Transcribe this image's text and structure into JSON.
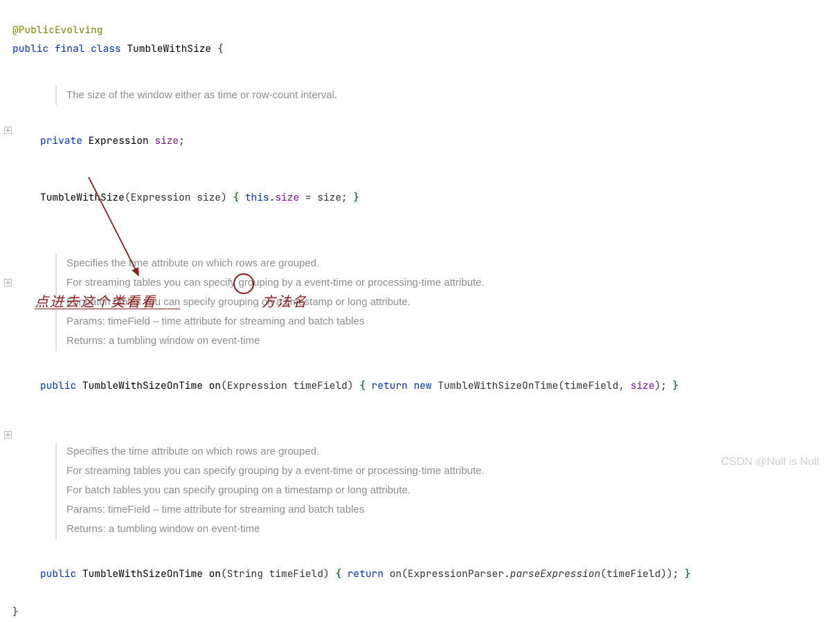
{
  "annotation": "@PublicEvolving",
  "decl": {
    "kw1": "public",
    "kw2": "final",
    "kw3": "class",
    "name": "TumbleWithSize",
    "brace": "{"
  },
  "doc1": "The size of the window either as time or row-count interval.",
  "field": {
    "kw": "private",
    "type": "Expression",
    "name": "size",
    "semi": ";"
  },
  "ctor": {
    "name": "TumbleWithSize",
    "params": "(Expression size)",
    "bopen": "{",
    "thisKw": "this",
    "dot": ".",
    "prop": "size",
    "assign": " = size; ",
    "bclose": "}"
  },
  "doc2": {
    "l1": "Specifies the time attribute on which rows are grouped.",
    "l2": "For streaming tables you can specify grouping by a event-time or processing-time attribute.",
    "l3": "For batch tables you can specify grouping on a timestamp or long attribute.",
    "l4": "Params:  timeField – time attribute for streaming and batch tables",
    "l5": "Returns: a tumbling window on event-time"
  },
  "m1": {
    "kw": "public",
    "ret": "TumbleWithSizeOnTime",
    "name": "on",
    "params": "(Expression timeField)",
    "bopen": "{",
    "rkw": "return",
    "nkw": "new",
    "call": "TumbleWithSizeOnTime(timeField, ",
    "prop": "size",
    "tail": "); ",
    "bclose": "}"
  },
  "doc3": {
    "l1": "Specifies the time attribute on which rows are grouped.",
    "l2": "For streaming tables you can specify grouping by a event-time or processing-time attribute.",
    "l3": "For batch tables you can specify grouping on a timestamp or long attribute.",
    "l4": "Params:  timeField – time attribute for streaming and batch tables",
    "l5": "Returns: a tumbling window on event-time"
  },
  "m2": {
    "kw": "public",
    "ret": "TumbleWithSizeOnTime",
    "name": "on",
    "params": "(String timeField)",
    "bopen": "{",
    "rkw": "return",
    "call": "on(ExpressionParser.",
    "it": "parseExpression",
    "tail": "(timeField)); ",
    "bclose": "}"
  },
  "closeBrace": "}",
  "hand1": "点进去这个类看看",
  "hand2": "方法名",
  "watermark": "CSDN @Null is Null"
}
